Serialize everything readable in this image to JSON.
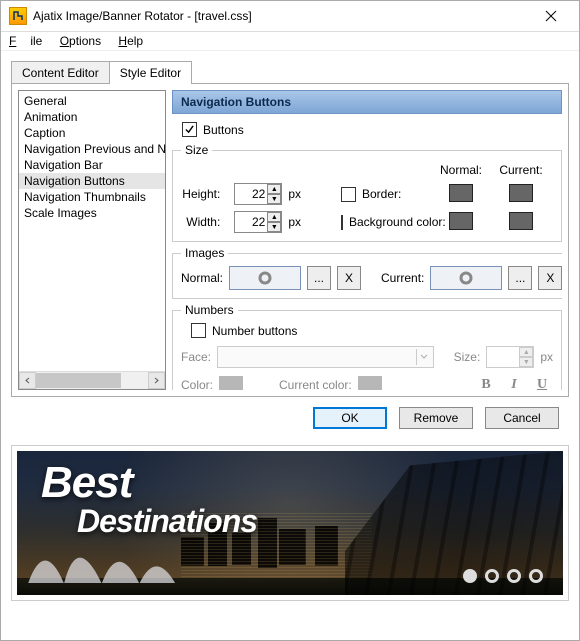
{
  "window": {
    "title": "Ajatix Image/Banner Rotator - [travel.css]"
  },
  "menu": {
    "file": "File",
    "options": "Options",
    "help": "Help"
  },
  "tabs": {
    "content": "Content Editor",
    "style": "Style Editor"
  },
  "sidebar": {
    "items": [
      "General",
      "Animation",
      "Caption",
      "Navigation Previous and Next",
      "Navigation Bar",
      "Navigation Buttons",
      "Navigation Thumbnails",
      "Scale Images"
    ],
    "selected_index": 5
  },
  "panel": {
    "title": "Navigation Buttons",
    "buttons_checkbox": {
      "label": "Buttons",
      "checked": true
    },
    "size": {
      "legend": "Size",
      "height_label": "Height:",
      "width_label": "Width:",
      "height": 22,
      "width": 22,
      "unit": "px",
      "border_label": "Border:",
      "border_checked": false,
      "bg_label": "Background color:",
      "bg_checked": false,
      "normal_label": "Normal:",
      "current_label": "Current:",
      "normal_border_color": "#6b6b6b",
      "current_border_color": "#6b6b6b",
      "normal_bg_color": "#6b6b6b",
      "current_bg_color": "#6b6b6b"
    },
    "images": {
      "legend": "Images",
      "normal_label": "Normal:",
      "current_label": "Current:",
      "browse": "...",
      "clear": "X"
    },
    "numbers": {
      "legend": "Numbers",
      "number_buttons_label": "Number buttons",
      "number_buttons_checked": false,
      "face_label": "Face:",
      "size_label": "Size:",
      "size_unit": "px",
      "color_label": "Color:",
      "current_color_label": "Current color:"
    }
  },
  "buttons": {
    "ok": "OK",
    "remove": "Remove",
    "cancel": "Cancel"
  },
  "preview": {
    "headline1": "Best",
    "headline2": "Destinations",
    "dot_count": 4,
    "current_dot": 0
  }
}
